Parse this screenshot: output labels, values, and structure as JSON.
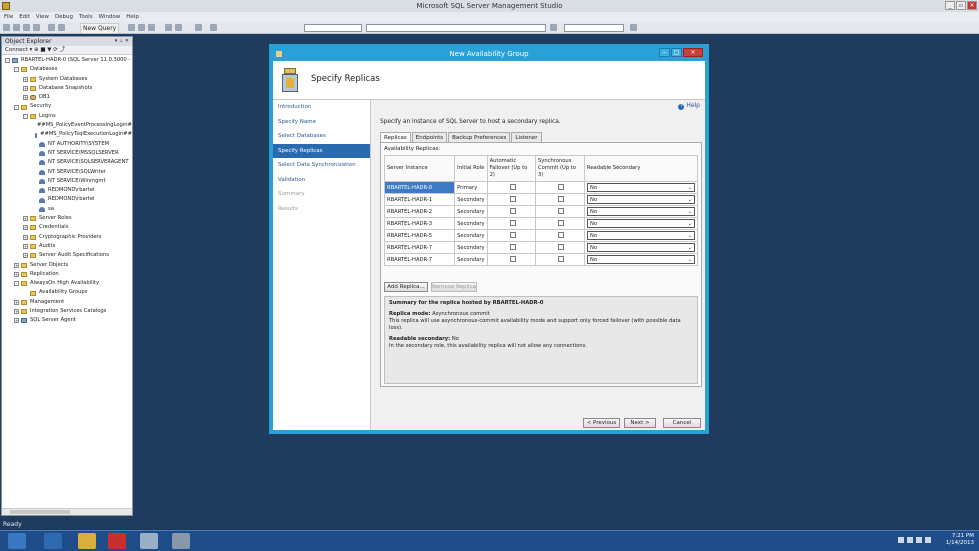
{
  "app": {
    "title": "Microsoft SQL Server Management Studio",
    "menu": [
      "File",
      "Edit",
      "View",
      "Debug",
      "Tools",
      "Window",
      "Help"
    ],
    "new_query": "New Query"
  },
  "object_explorer": {
    "title": "Object Explorer",
    "connect": "Connect",
    "nodes": [
      {
        "label": "RBARTEL-HADR-0 (SQL Server 11.0.3000 -",
        "indent": 0,
        "exp": "-",
        "icon": "server"
      },
      {
        "label": "Databases",
        "indent": 1,
        "exp": "-",
        "icon": "folder"
      },
      {
        "label": "System Databases",
        "indent": 2,
        "exp": "+",
        "icon": "folder"
      },
      {
        "label": "Database Snapshots",
        "indent": 2,
        "exp": "+",
        "icon": "folder"
      },
      {
        "label": "DB1",
        "indent": 2,
        "exp": "+",
        "icon": "db"
      },
      {
        "label": "Security",
        "indent": 1,
        "exp": "-",
        "icon": "folder"
      },
      {
        "label": "Logins",
        "indent": 2,
        "exp": "-",
        "icon": "folder"
      },
      {
        "label": "##MS_PolicyEventProcessingLogin##",
        "indent": 3,
        "exp": "",
        "icon": "user"
      },
      {
        "label": "##MS_PolicyTsqlExecutionLogin##",
        "indent": 3,
        "exp": "",
        "icon": "user"
      },
      {
        "label": "NT AUTHORITY\\SYSTEM",
        "indent": 3,
        "exp": "",
        "icon": "user"
      },
      {
        "label": "NT SERVICE\\MSSQLSERVER",
        "indent": 3,
        "exp": "",
        "icon": "user"
      },
      {
        "label": "NT SERVICE\\SQLSERVERAGENT",
        "indent": 3,
        "exp": "",
        "icon": "user"
      },
      {
        "label": "NT SERVICE\\SQLWriter",
        "indent": 3,
        "exp": "",
        "icon": "user"
      },
      {
        "label": "NT SERVICE\\Winmgmt",
        "indent": 3,
        "exp": "",
        "icon": "user"
      },
      {
        "label": "REDMOND\\rbartel",
        "indent": 3,
        "exp": "",
        "icon": "user"
      },
      {
        "label": "REDMOND\\rbartel",
        "indent": 3,
        "exp": "",
        "icon": "user"
      },
      {
        "label": "sa",
        "indent": 3,
        "exp": "",
        "icon": "user"
      },
      {
        "label": "Server Roles",
        "indent": 2,
        "exp": "+",
        "icon": "folder"
      },
      {
        "label": "Credentials",
        "indent": 2,
        "exp": "+",
        "icon": "folder"
      },
      {
        "label": "Cryptographic Providers",
        "indent": 2,
        "exp": "+",
        "icon": "folder"
      },
      {
        "label": "Audits",
        "indent": 2,
        "exp": "+",
        "icon": "folder"
      },
      {
        "label": "Server Audit Specifications",
        "indent": 2,
        "exp": "+",
        "icon": "folder"
      },
      {
        "label": "Server Objects",
        "indent": 1,
        "exp": "+",
        "icon": "folder"
      },
      {
        "label": "Replication",
        "indent": 1,
        "exp": "+",
        "icon": "folder"
      },
      {
        "label": "AlwaysOn High Availability",
        "indent": 1,
        "exp": "-",
        "icon": "folder"
      },
      {
        "label": "Availability Groups",
        "indent": 2,
        "exp": "",
        "icon": "folder"
      },
      {
        "label": "Management",
        "indent": 1,
        "exp": "+",
        "icon": "folder"
      },
      {
        "label": "Integration Services Catalogs",
        "indent": 1,
        "exp": "+",
        "icon": "folder"
      },
      {
        "label": "SQL Server Agent",
        "indent": 1,
        "exp": "+",
        "icon": "server"
      }
    ]
  },
  "status": "Ready",
  "dialog": {
    "title": "New Availability Group",
    "page_title": "Specify Replicas",
    "help": "Help",
    "nav": [
      {
        "label": "Introduction",
        "state": "normal"
      },
      {
        "label": "Specify Name",
        "state": "normal"
      },
      {
        "label": "Select Databases",
        "state": "normal"
      },
      {
        "label": "Specify Replicas",
        "state": "active"
      },
      {
        "label": "Select Data Synchronization",
        "state": "normal"
      },
      {
        "label": "Validation",
        "state": "normal"
      },
      {
        "label": "Summary",
        "state": "disabled"
      },
      {
        "label": "Results",
        "state": "disabled"
      }
    ],
    "instruction": "Specify an instance of SQL Server to host a secondary replica.",
    "tabs": [
      "Replicas",
      "Endpoints",
      "Backup Preferences",
      "Listener"
    ],
    "availability_label": "Availability Replicas:",
    "columns": [
      "Server Instance",
      "Initial Role",
      "Automatic Failover (Up to 2)",
      "Synchronous Commit (Up to 3)",
      "Readable Secondary"
    ],
    "replicas": [
      {
        "server": "RBARTEL-HADR-0",
        "role": "Primary",
        "readable": "No"
      },
      {
        "server": "RBARTEL-HADR-1",
        "role": "Secondary",
        "readable": "No"
      },
      {
        "server": "RBARTEL-HADR-2",
        "role": "Secondary",
        "readable": "No"
      },
      {
        "server": "RBARTEL-HADR-3",
        "role": "Secondary",
        "readable": "No"
      },
      {
        "server": "RBARTEL-HADR-5",
        "role": "Secondary",
        "readable": "No"
      },
      {
        "server": "RBARTEL-HADR-7",
        "role": "Secondary",
        "readable": "No"
      },
      {
        "server": "RBARTEL-HADR-7",
        "role": "Secondary",
        "readable": "No"
      }
    ],
    "add_replica": "Add Replica...",
    "remove_replica": "Remove Replica",
    "summary": {
      "title": "Summary for the replica hosted by RBARTEL-HADR-0",
      "mode_label": "Replica mode:",
      "mode_value": "Asynchronous commit",
      "mode_desc": "This replica will use asynchronous-commit availability mode and support only forced failover (with possible data loss).",
      "readable_label": "Readable secondary:",
      "readable_value": "No",
      "readable_desc": "In the secondary role, this availability replica will not allow any connections."
    },
    "prev": "< Previous",
    "next": "Next >",
    "cancel": "Cancel"
  },
  "taskbar": {
    "time": "7:21 PM",
    "date": "1/14/2013"
  }
}
